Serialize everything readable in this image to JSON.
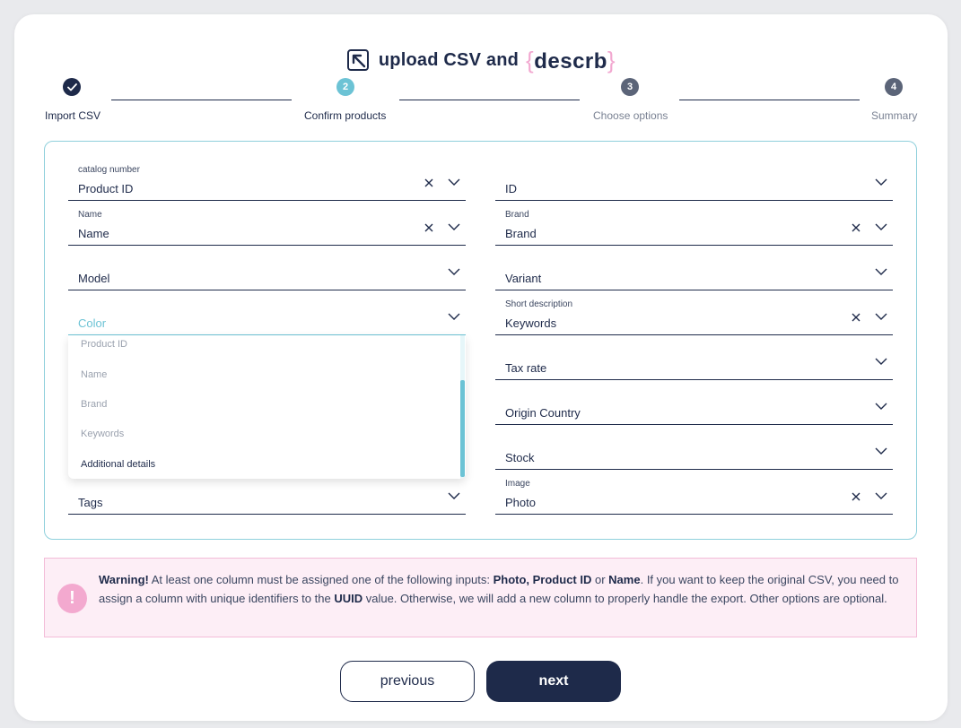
{
  "header": {
    "title": "upload CSV and",
    "brand": "descrb",
    "logo_icon": "upload-arrow-icon"
  },
  "stepper": [
    {
      "number": "✓",
      "label": "Import CSV",
      "state": "done"
    },
    {
      "number": "2",
      "label": "Confirm products",
      "state": "current"
    },
    {
      "number": "3",
      "label": "Choose options",
      "state": "upcoming"
    },
    {
      "number": "4",
      "label": "Summary",
      "state": "upcoming"
    }
  ],
  "fields_left": [
    {
      "label": "catalog number",
      "value": "Product ID",
      "clearable": true
    },
    {
      "label": "Name",
      "value": "Name",
      "clearable": true
    },
    {
      "label": "",
      "value": "Model",
      "clearable": false
    },
    {
      "label": "",
      "value": "Color",
      "clearable": false,
      "active": true
    },
    {
      "label": "",
      "value": "Tags",
      "clearable": false
    }
  ],
  "fields_right": [
    {
      "label": "",
      "value": "ID",
      "clearable": false
    },
    {
      "label": "Brand",
      "value": "Brand",
      "clearable": true
    },
    {
      "label": "",
      "value": "Variant",
      "clearable": false
    },
    {
      "label": "Short description",
      "value": "Keywords",
      "clearable": true
    },
    {
      "label": "",
      "value": "Tax rate",
      "clearable": false
    },
    {
      "label": "",
      "value": "Origin Country",
      "clearable": false
    },
    {
      "label": "",
      "value": "Stock",
      "clearable": false
    },
    {
      "label": "Image",
      "value": "Photo",
      "clearable": true
    }
  ],
  "dropdown": {
    "options": [
      {
        "label": "Product ID",
        "enabled": false
      },
      {
        "label": "Name",
        "enabled": false
      },
      {
        "label": "Brand",
        "enabled": false
      },
      {
        "label": "Keywords",
        "enabled": false
      },
      {
        "label": "Additional details",
        "enabled": true
      }
    ]
  },
  "warning": {
    "prefix": "Warning!",
    "text1": " At least one column must be assigned one of the following inputs: ",
    "bold1": "Photo, Product ID",
    "text2": " or ",
    "bold2": "Name",
    "text3": ". If you want to keep the original CSV, you need to assign a column with unique identifiers to the ",
    "bold3": "UUID",
    "text4": " value. Otherwise, we will add a new column to properly handle the export. Other options are optional.",
    "icon": "!"
  },
  "buttons": {
    "previous": "previous",
    "next": "next"
  },
  "colors": {
    "navy": "#1e2a4a",
    "teal": "#6cc3d5",
    "step_gray": "#5b6478",
    "pink": "#f3a9cf"
  }
}
